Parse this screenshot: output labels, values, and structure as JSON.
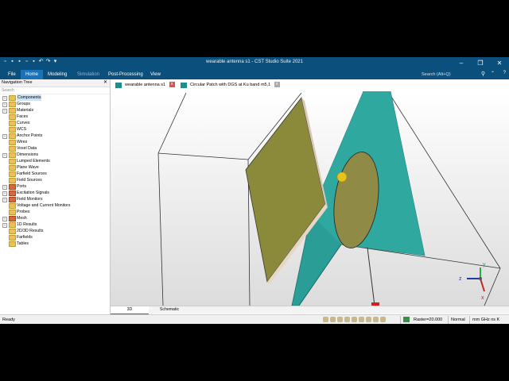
{
  "window": {
    "title": "wearable antenna s1 - CST Studio Suite 2021",
    "quick_access_icons": [
      "new-icon",
      "open-icon",
      "save-icon",
      "copy-icon",
      "print-icon",
      "undo-icon",
      "redo-icon",
      "dropdown-icon"
    ],
    "controls": [
      "minimize-icon",
      "restore-icon",
      "close-icon"
    ]
  },
  "menu": {
    "items": [
      "File",
      "Home",
      "Modeling",
      "Simulation",
      "Post-Processing",
      "View"
    ],
    "active": "Home",
    "search_placeholder": "Search (Alt+Q)"
  },
  "nav": {
    "title": "Navigation Tree",
    "search_label": "Search",
    "items": [
      {
        "label": "Components",
        "expand": "+",
        "selected": true
      },
      {
        "label": "Groups",
        "expand": "+"
      },
      {
        "label": "Materials",
        "expand": "+"
      },
      {
        "label": "Faces",
        "expand": ""
      },
      {
        "label": "Curves",
        "expand": ""
      },
      {
        "label": "WCS",
        "expand": ""
      },
      {
        "label": "Anchor Points",
        "expand": "+"
      },
      {
        "label": "Wires",
        "expand": ""
      },
      {
        "label": "Voxel Data",
        "expand": ""
      },
      {
        "label": "Dimensions",
        "expand": "+"
      },
      {
        "label": "Lumped Elements",
        "expand": ""
      },
      {
        "label": "Plane Wave",
        "expand": ""
      },
      {
        "label": "Farfield Sources",
        "expand": ""
      },
      {
        "label": "Field Sources",
        "expand": ""
      },
      {
        "label": "Ports",
        "expand": "+"
      },
      {
        "label": "Excitation Signals",
        "expand": "+"
      },
      {
        "label": "Field Monitors",
        "expand": "+"
      },
      {
        "label": "Voltage and Current Monitors",
        "expand": ""
      },
      {
        "label": "Probes",
        "expand": ""
      },
      {
        "label": "Mesh",
        "expand": "+"
      },
      {
        "label": "1D Results",
        "expand": "+"
      },
      {
        "label": "2D/3D Results",
        "expand": ""
      },
      {
        "label": "Farfields",
        "expand": ""
      },
      {
        "label": "Tables",
        "expand": ""
      }
    ]
  },
  "doc_tabs": [
    {
      "label": "wearable antenna s1"
    },
    {
      "label": "Circular Patch with DGS at Ku band m5,1"
    }
  ],
  "view_tabs": [
    "3D",
    "Schematic"
  ],
  "axes": {
    "x": "x",
    "y": "y",
    "z": "z"
  },
  "status": {
    "left": "Ready",
    "raster": "Raster=20.000",
    "mode": "Normal",
    "units": "mm  GHz  ns  K"
  },
  "colors": {
    "titlebar": "#0b4f7c",
    "menu_active": "#1a73b8",
    "patch": "#8a8a3a",
    "substrate": "#2a9d96",
    "ellipse": "#8f8a45"
  }
}
